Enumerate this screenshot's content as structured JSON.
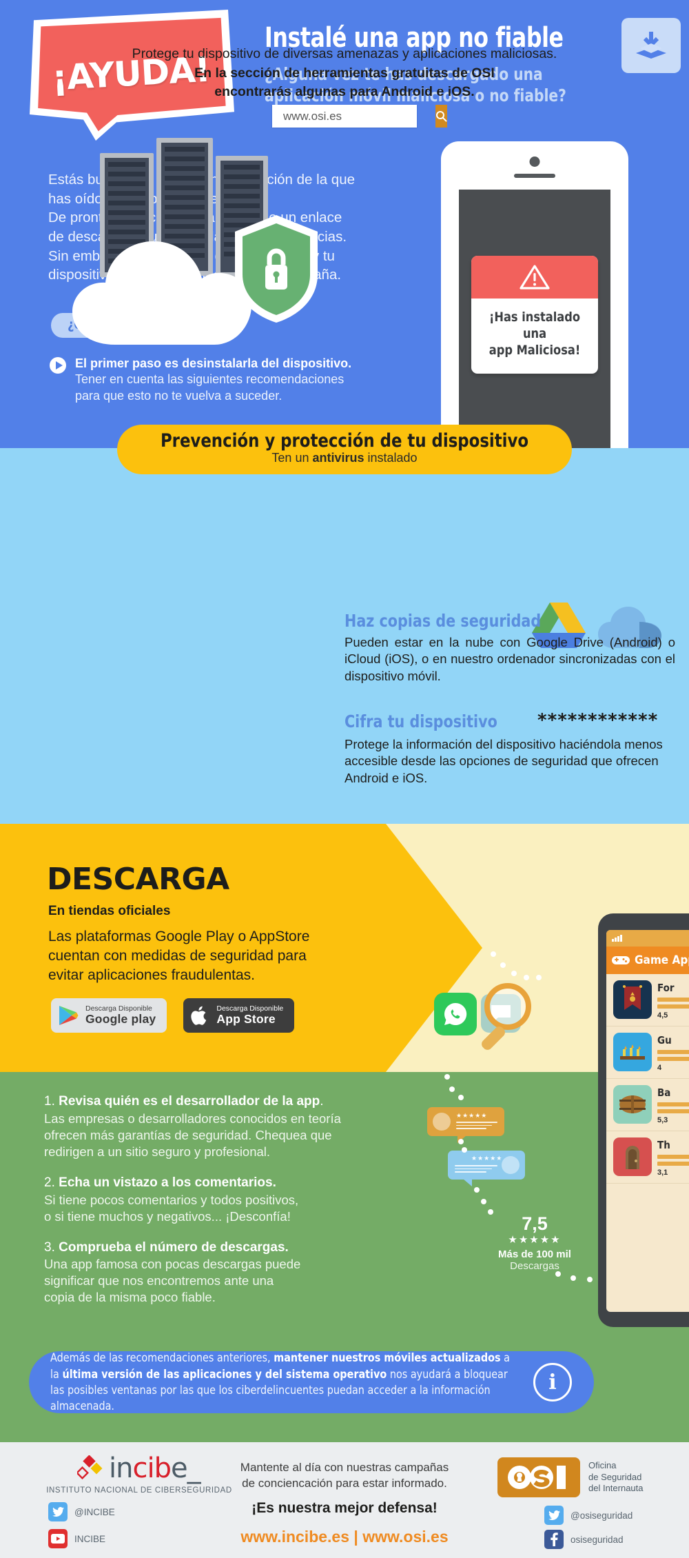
{
  "hero": {
    "bubble_text": "¡AYUDA!",
    "title": "Instalé una app no fiable",
    "subtitle_line1": "¿Alguna vez te has descargado una",
    "subtitle_line2": "aplicación móvil maliciosa o no fiable?",
    "download_icon": "download-tray-icon",
    "paragraph": {
      "line1_a": "Estás buscando",
      "line1_b": "una aplicación de la que",
      "line2": "has oído hablar por Internet.",
      "line3": "De pronto, la encuentras a través de un enlace",
      "line4": "de descarga de una web, la instalas y la inicias.",
      "line5": "Sin embargo, no ocurre lo que esperabas y tu",
      "line6": "dispositivo empieza a actuar de forma extraña."
    },
    "pill_label": "¿Qué puedes hacer?",
    "bullet": {
      "bold": "El primer paso es desinstalarla del dispositivo",
      "bold_tail": ".",
      "rest_line1": "Tener en cuenta las siguientes recomendaciones",
      "rest_line2": "para que esto no te vuelva a suceder."
    },
    "phone_alert": {
      "warning_icon": "warning-triangle-icon",
      "line1": "¡Has instalado una",
      "line2": "app Maliciosa!"
    }
  },
  "banner": {
    "title": "Prevención y protección de tu dispositivo",
    "sub_pre": "Ten un ",
    "sub_bold": "antivirus",
    "sub_post": " instalado"
  },
  "prevention": {
    "lead_line1": "Protege tu dispositivo de diversas amenazas y aplicaciones maliciosas.",
    "lead_bold1": "En la sección de herramientas gratuitas de OSI",
    "lead_bold2": "encontrarás algunas para Android e iOS.",
    "search": {
      "value": "www.osi.es",
      "placeholder": "www.osi.es",
      "button_icon": "search-icon"
    },
    "backup": {
      "title": "Haz copias de seguridad",
      "body": "Pueden estar en la nube con Google Drive (Android) o iCloud (iOS), o en nuestro ordenador sincronizadas con el dispositivo móvil.",
      "icon1": "google-drive-icon",
      "icon2": "icloud-icon"
    },
    "encrypt": {
      "title": "Cifra tu dispositivo",
      "asterisks": "************",
      "body": "Protege la información del dispositivo haciéndola menos accesible desde las opciones de seguridad que ofrecen Android e iOS."
    },
    "illustration": {
      "servers": "server-rack-icon",
      "cloud": "cloud-icon",
      "shield": "shield-lock-icon"
    }
  },
  "download": {
    "title": "DESCARGA",
    "subtitle": "En tiendas oficiales",
    "body_line1": "Las plataformas Google Play o AppStore",
    "body_line2": "cuentan con medidas de seguridad para",
    "body_line3": "evitar aplicaciones fraudulentas.",
    "badges": [
      {
        "small": "Descarga Disponible",
        "big": "Google play",
        "icon": "google-play-icon",
        "style": "light"
      },
      {
        "small": "Descarga Disponible",
        "big": "App Store",
        "icon": "apple-icon",
        "style": "dark"
      }
    ]
  },
  "phone_apps": {
    "header_title": "Game App",
    "header_icon": "gamepad-icon",
    "signal_icon": "signal-bars-icon",
    "apps": [
      {
        "name": "For",
        "score": "4,5",
        "icon": "banner-flag-icon"
      },
      {
        "name": "Gu",
        "score": "4",
        "icon": "guerras-medievales-icon"
      },
      {
        "name": "Ba",
        "score": "5,3",
        "icon": "barriles-piratas-icon"
      },
      {
        "name": "Th",
        "score": "3,1",
        "icon": "the-dungeon-icon"
      }
    ]
  },
  "tips": [
    {
      "number": "1.",
      "heading": "Revisa quién es el desarrollador de la app",
      "heading_tail": ".",
      "body_line1": "Las empresas o desarrolladores conocidos en teoría",
      "body_line2": "ofrecen más garantías de seguridad. Chequea que",
      "body_line3": "redirigen a un sitio seguro y profesional."
    },
    {
      "number": "2.",
      "heading": "Echa un vistazo a los comentarios.",
      "heading_tail": "",
      "body_line1": "Si tiene pocos comentarios y todos positivos,",
      "body_line2": "o si tiene muchos y negativos... ¡Desconfía!",
      "body_line3": ""
    },
    {
      "number": "3.",
      "heading": "Comprueba el número de descargas.",
      "heading_tail": "",
      "body_line1": "Una app famosa con pocas descargas puede",
      "body_line2": "significar que nos encontremos ante una",
      "body_line3": "copia de la misma poco fiable."
    }
  ],
  "rating": {
    "value": "7,5",
    "stars": "★★★★★",
    "label_bold": "Más de 100 mil",
    "label": "Descargas",
    "bubble_orange_stars": "★★★★★",
    "bubble_blue_stars": "★★★★★"
  },
  "infobox": {
    "t1": "Además de las recomendaciones anteriores, ",
    "b1": "mantener nuestros móviles actualizados",
    "t2": " a la ",
    "b2": "última versión de las aplicaciones y del sistema operativo",
    "t3": " nos ayudará a bloquear las posibles ventanas por las que los ciberdelincuentes puedan acceder a la información almacenada.",
    "icon": "info-circle-icon"
  },
  "footer": {
    "incibe": {
      "word_a": "in",
      "word_b": "cib",
      "word_c": "e_",
      "subtitle": "INSTITUTO NACIONAL DE CIBERSEGURIDAD",
      "twitter": "@INCIBE",
      "youtube": "INCIBE",
      "logo_icon": "incibe-diamond-icon",
      "twitter_icon": "twitter-icon",
      "youtube_icon": "youtube-icon"
    },
    "center": {
      "line1": "Mantente al día con nuestras campañas",
      "line2": "de conciencación para estar informado.",
      "tagline": "¡Es nuestra mejor defensa!",
      "urls": "www.incibe.es | www.osi.es"
    },
    "osi": {
      "logo_text": "OSI",
      "desc_line1": "Oficina",
      "desc_line2": "de Seguridad",
      "desc_line3": "del Internauta",
      "twitter": "@osiseguridad",
      "facebook": "osiseguridad",
      "twitter_icon": "twitter-icon",
      "facebook_icon": "facebook-icon"
    }
  },
  "colors": {
    "hero_blue": "#5280e8",
    "red": "#f2615c",
    "yellow": "#fcc10d",
    "light_blue": "#92d5f7",
    "green": "#74ac66",
    "orange": "#ef8b22"
  }
}
